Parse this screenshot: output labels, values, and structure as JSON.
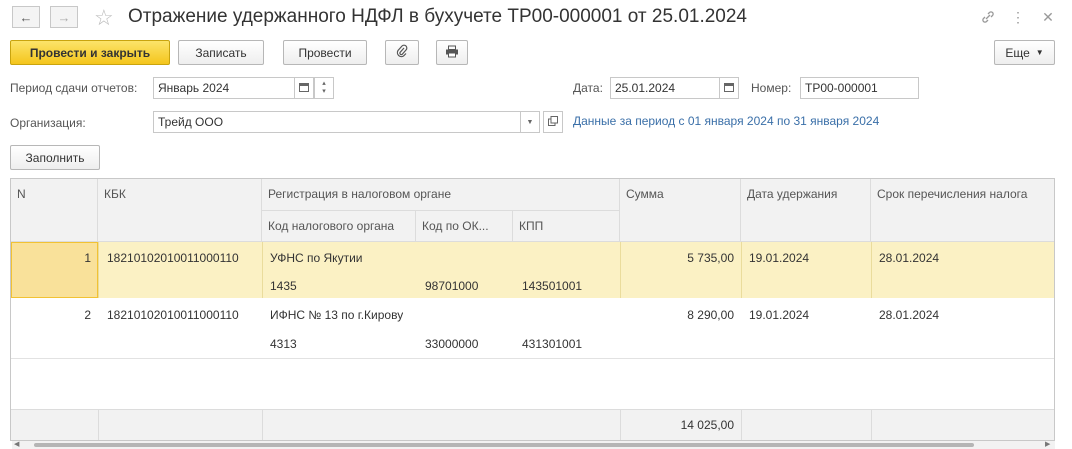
{
  "window": {
    "title": "Отражение удержанного НДФЛ в бухучете ТР00-000001 от 25.01.2024",
    "back_icon": "arrow-left-icon",
    "forward_icon": "arrow-right-icon",
    "star_icon": "star-icon",
    "link_icon": "link-icon",
    "more_icon": "vertical-dots-icon",
    "close_icon": "close-icon"
  },
  "toolbar": {
    "post_close": "Провести и закрыть",
    "save": "Записать",
    "post": "Провести",
    "attach_icon": "paperclip-icon",
    "print_icon": "printer-icon",
    "more": "Еще"
  },
  "form": {
    "period_label": "Период сдачи отчетов:",
    "period_value": "Январь 2024",
    "date_label": "Дата:",
    "date_value": "25.01.2024",
    "number_label": "Номер:",
    "number_value": "ТР00-000001",
    "org_label": "Организация:",
    "org_value": "Трейд ООО",
    "period_link": "Данные за период с 01 января 2024 по 31 января 2024",
    "fill_button": "Заполнить"
  },
  "table": {
    "headers": {
      "n": "N",
      "kbk": "КБК",
      "registration": "Регистрация в налоговом органе",
      "tax_code": "Код налогового органа",
      "okato": "Код по ОК...",
      "kpp": "КПП",
      "sum": "Сумма",
      "hold_date": "Дата удержания",
      "transfer_date": "Срок перечисления налога"
    },
    "rows": [
      {
        "n": "1",
        "kbk": "18210102010011000110",
        "org": "УФНС по Якутии",
        "tax_code": "1435",
        "okato": "98701000",
        "kpp": "143501001",
        "sum": "5 735,00",
        "hold_date": "19.01.2024",
        "transfer_date": "28.01.2024"
      },
      {
        "n": "2",
        "kbk": "18210102010011000110",
        "org": "ИФНС № 13 по г.Кирову",
        "tax_code": "4313",
        "okato": "33000000",
        "kpp": "431301001",
        "sum": "8 290,00",
        "hold_date": "19.01.2024",
        "transfer_date": "28.01.2024"
      }
    ],
    "total": "14 025,00"
  }
}
